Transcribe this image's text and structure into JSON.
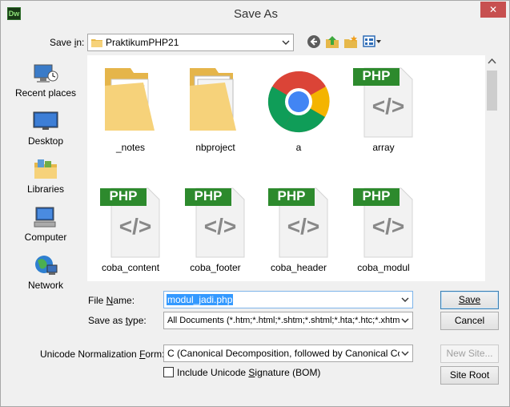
{
  "window": {
    "title": "Save As",
    "app_icon_text": "Dw",
    "close_glyph": "✕"
  },
  "location": {
    "label": "Save in:",
    "label_pre": "Save ",
    "label_key": "i",
    "label_post": "n:",
    "value": "PraktikumPHP21"
  },
  "toolbar": {
    "icons": [
      "back-icon",
      "up-folder-icon",
      "new-folder-icon",
      "view-menu-icon"
    ]
  },
  "places": [
    {
      "label": "Recent places",
      "icon": "recent-places-icon"
    },
    {
      "label": "Desktop",
      "icon": "desktop-icon"
    },
    {
      "label": "Libraries",
      "icon": "libraries-icon"
    },
    {
      "label": "Computer",
      "icon": "computer-icon"
    },
    {
      "label": "Network",
      "icon": "network-icon"
    }
  ],
  "files": [
    {
      "name": "_notes",
      "type": "folder"
    },
    {
      "name": "nbproject",
      "type": "folder"
    },
    {
      "name": "a",
      "type": "chrome"
    },
    {
      "name": "array",
      "type": "php"
    },
    {
      "name": "coba_content",
      "type": "php"
    },
    {
      "name": "coba_footer",
      "type": "php"
    },
    {
      "name": "coba_header",
      "type": "php"
    },
    {
      "name": "coba_modul",
      "type": "php"
    }
  ],
  "php_badge": "PHP",
  "php_glyph": "</>",
  "filename": {
    "label": "File name:",
    "label_key": "N",
    "value": "modul_jadi.php"
  },
  "savetype": {
    "label": "Save as type:",
    "label_key": "t",
    "value": "All Documents (*.htm;*.html;*.shtm;*.shtml;*.hta;*.htc;*.xhtml;*.s"
  },
  "normalization": {
    "label": "Unicode Normalization Form:",
    "label_key": "F",
    "value": "C (Canonical Decomposition, followed by Canonical Composi"
  },
  "bom": {
    "label": "Include Unicode Signature (BOM)",
    "label_key": "S",
    "checked": false
  },
  "buttons": {
    "save": "Save",
    "cancel": "Cancel",
    "new_site": "New Site...",
    "site_root": "Site Root"
  },
  "colors": {
    "php_green": "#2d8a2d",
    "folder_yellow": "#f3d27a",
    "selection_blue": "#3399ff",
    "close_red": "#c75050"
  }
}
